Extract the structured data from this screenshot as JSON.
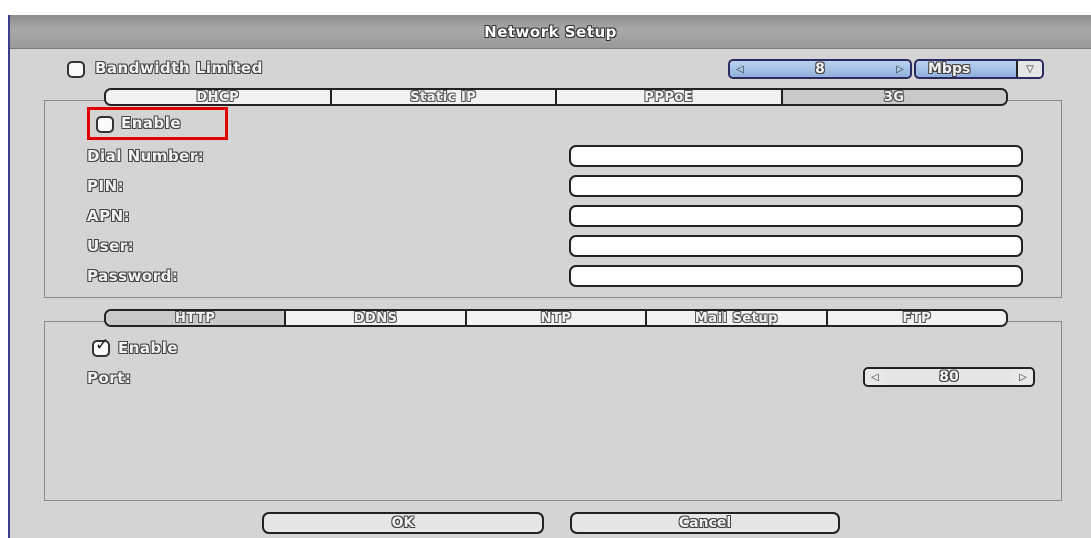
{
  "window": {
    "title": "Network Setup"
  },
  "bandwidth": {
    "label": "Bandwidth Limited",
    "checked": false,
    "value": "8",
    "unit": "Mbps",
    "left_icon": "arrow-left-icon",
    "right_icon": "arrow-right-icon",
    "dropdown_icon": "chevron-down-icon"
  },
  "connection_tabs": [
    {
      "label": "DHCP",
      "active": false
    },
    {
      "label": "Static IP",
      "active": false
    },
    {
      "label": "PPPoE",
      "active": false
    },
    {
      "label": "3G",
      "active": true
    }
  ],
  "g3": {
    "enable_label": "Enable",
    "enabled": false,
    "fields": [
      {
        "label": "Dial Number:",
        "value": ""
      },
      {
        "label": "PIN:",
        "value": ""
      },
      {
        "label": "APN:",
        "value": ""
      },
      {
        "label": "User:",
        "value": ""
      },
      {
        "label": "Password:",
        "value": ""
      }
    ]
  },
  "service_tabs": [
    {
      "label": "HTTP",
      "active": true
    },
    {
      "label": "DDNS",
      "active": false
    },
    {
      "label": "NTP",
      "active": false
    },
    {
      "label": "Mail Setup",
      "active": false
    },
    {
      "label": "FTP",
      "active": false
    }
  ],
  "http": {
    "enable_label": "Enable",
    "enabled": true,
    "port_label": "Port:",
    "port_value": "80"
  },
  "buttons": {
    "ok": "OK",
    "cancel": "Cancel"
  },
  "colors": {
    "highlight": "#e00000",
    "spinner_accent": "#8fb0dc"
  }
}
